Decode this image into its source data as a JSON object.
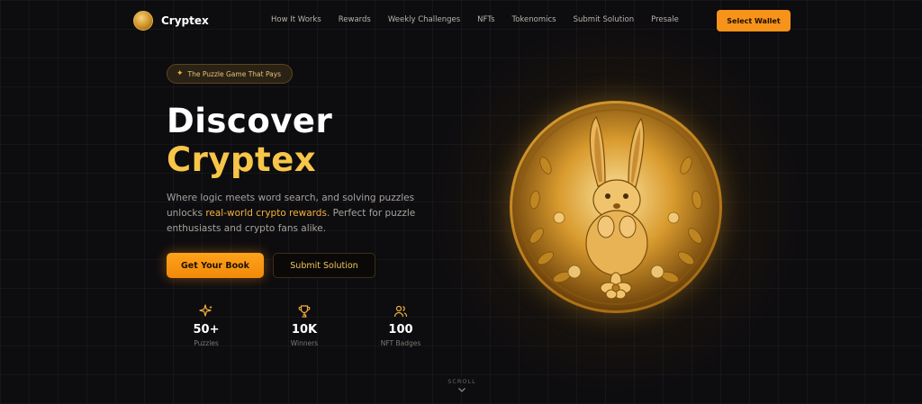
{
  "brand": {
    "name": "Cryptex",
    "logo_icon": "coin-logo-icon"
  },
  "nav": {
    "links": [
      "How It Works",
      "Rewards",
      "Weekly Challenges",
      "NFTs",
      "Tokenomics",
      "Submit Solution",
      "Presale"
    ],
    "wallet_button": "Select Wallet"
  },
  "hero": {
    "badge": "The Puzzle Game That Pays",
    "badge_icon": "sparkle-icon",
    "title_line1": "Discover",
    "title_line2": "Cryptex",
    "description_pre": "Where logic meets word search, and solving puzzles unlocks ",
    "description_highlight": "real-world crypto rewards",
    "description_post": ". Perfect for puzzle enthusiasts and crypto fans alike.",
    "primary_button": "Get Your Book",
    "secondary_button": "Submit Solution"
  },
  "stats": [
    {
      "icon": "sparkles-icon",
      "value": "50+",
      "label": "Puzzles"
    },
    {
      "icon": "trophy-icon",
      "value": "10K",
      "label": "Winners"
    },
    {
      "icon": "users-icon",
      "value": "100",
      "label": "NFT Badges"
    }
  ],
  "scroll": {
    "label": "SCROLL",
    "icon": "chevron-down-icon"
  },
  "colors": {
    "accent": "#f7931a",
    "gold": "#f7c548",
    "background": "#0d0c0f"
  }
}
